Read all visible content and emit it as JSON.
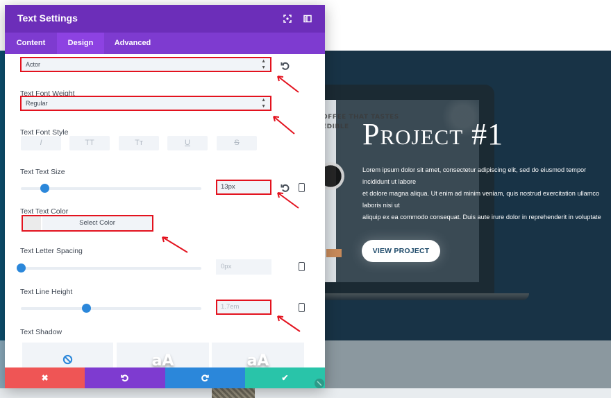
{
  "modal": {
    "title": "Text Settings",
    "header_icons": [
      "expand-icon",
      "split-view-icon"
    ],
    "tabs": [
      {
        "label": "Content",
        "active": false
      },
      {
        "label": "Design",
        "active": true
      },
      {
        "label": "Advanced",
        "active": false
      }
    ],
    "fields": {
      "font": {
        "value": "Actor"
      },
      "font_weight": {
        "label": "Text Font Weight",
        "value": "Regular"
      },
      "font_style": {
        "label": "Text Font Style",
        "options": [
          {
            "name": "italic",
            "glyph": "I"
          },
          {
            "name": "uppercase",
            "glyph": "TT"
          },
          {
            "name": "small-caps",
            "glyph": "Tт"
          },
          {
            "name": "underline",
            "glyph": "U"
          },
          {
            "name": "strikethrough",
            "glyph": "S"
          }
        ]
      },
      "text_size": {
        "label": "Text Text Size",
        "value": "13px",
        "slider_percent": 13
      },
      "text_color": {
        "label": "Text Text Color",
        "button_label": "Select Color",
        "swatch": "#ebebeb"
      },
      "letter_spacing": {
        "label": "Text Letter Spacing",
        "value": "0px",
        "slider_percent": 0
      },
      "line_height": {
        "label": "Text Line Height",
        "value": "1.7em",
        "slider_percent": 36
      },
      "text_shadow": {
        "label": "Text Shadow",
        "options": [
          {
            "name": "none",
            "glyph": ""
          },
          {
            "name": "preset-1",
            "glyph": "aA"
          },
          {
            "name": "preset-2",
            "glyph": "aA"
          }
        ]
      }
    },
    "footer": {
      "cancel": "✖",
      "undo": "↶",
      "redo": "↷",
      "save": "✔"
    },
    "colors": {
      "header": "#6c2eb9",
      "tabs": "#7e3bd0",
      "active_tab": "#8d42e2",
      "highlight": "#e3121e",
      "slider": "#2b87da",
      "cancel": "#ef5555",
      "undo": "#7e3bd0",
      "redo": "#2b87da",
      "save": "#29c4a9"
    }
  },
  "background_site": {
    "laptop_screen_heading": "OFFEE THAT TASTES\nEDIBLE",
    "project_title": "Project #1",
    "project_text": "Lorem ipsum dolor sit amet, consectetur adipiscing elit, sed do eiusmod tempor incididunt ut labore\net dolore magna aliqua. Ut enim ad minim veniam, quis nostrud exercitation ullamco laboris nisi ut\naliquip ex ea commodo consequat. Duis aute irure dolor in reprehenderit in voluptate velit esse\ncillum dolore eu fugiat nulla pariatur. Excepteur sint occaecat cupidatat non proident, sunt in culpa\nqui officia deserunt mollit anim id est laborum.",
    "cta_button": "VIEW PROJECT",
    "colors": {
      "hero": "#183346",
      "lower": "#8b989f"
    }
  }
}
